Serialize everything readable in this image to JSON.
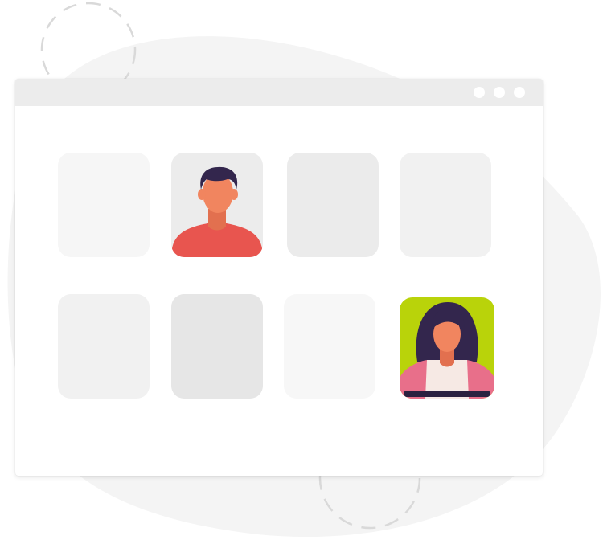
{
  "window": {
    "control_dots": [
      "dot",
      "dot",
      "dot"
    ]
  },
  "tiles": [
    {
      "state": "empty",
      "color": "#f6f6f6"
    },
    {
      "state": "participant",
      "avatar": "man-avatar-icon",
      "color": "#ececec"
    },
    {
      "state": "empty",
      "color": "#ebebeb"
    },
    {
      "state": "empty",
      "color": "#f1f1f1"
    },
    {
      "state": "empty",
      "color": "#f1f1f1"
    },
    {
      "state": "empty",
      "color": "#e6e6e6"
    },
    {
      "state": "empty",
      "color": "#f7f7f7"
    },
    {
      "state": "participant",
      "avatar": "woman-avatar-icon",
      "color": "#b9d30a"
    }
  ],
  "colors": {
    "background_blob": "#f4f4f4",
    "accent_green": "#b9d30a",
    "shirt_red": "#e8554f",
    "hair_navy": "#33264d",
    "skin": "#f1855f"
  }
}
